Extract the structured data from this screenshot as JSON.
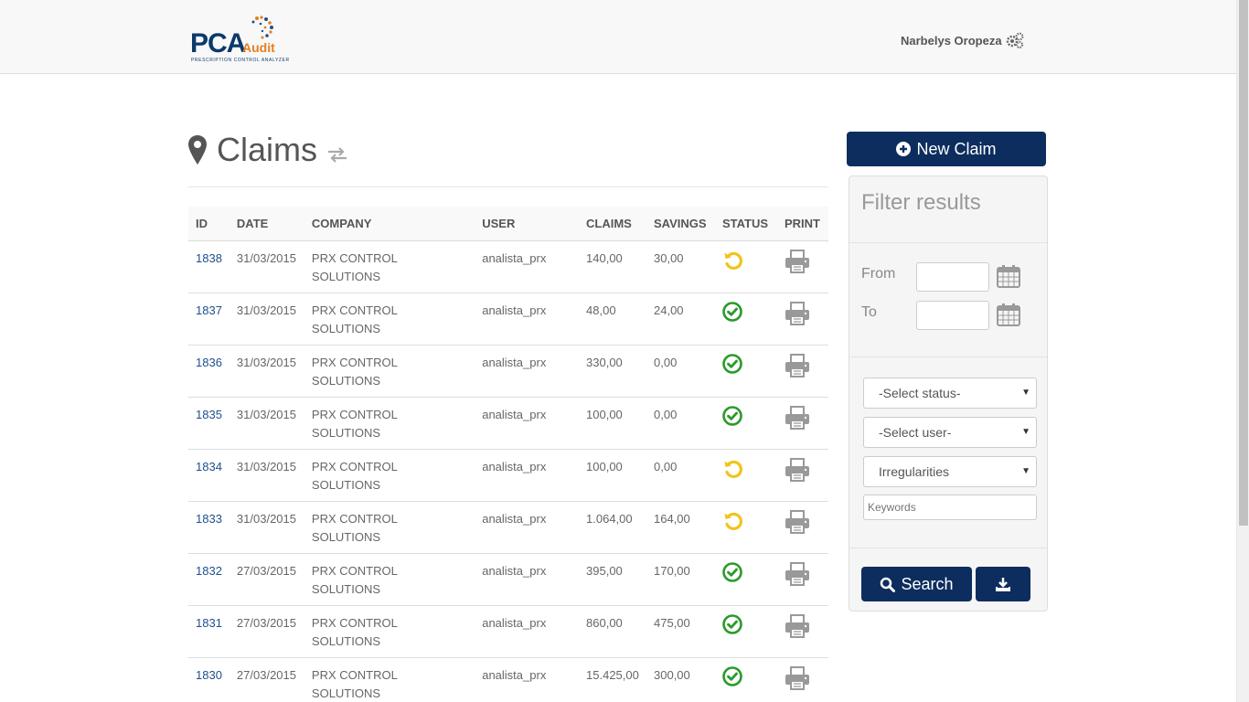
{
  "app": {
    "logo_main": "PCA",
    "logo_sub": "Audit",
    "logo_tagline": "PRESCRIPTION CONTROL ANALYZER",
    "user_name": "Narbelys Oropeza"
  },
  "page": {
    "title": "Claims"
  },
  "table": {
    "headers": {
      "id": "ID",
      "date": "DATE",
      "company": "COMPANY",
      "user": "USER",
      "claims": "CLAIMS",
      "savings": "SAVINGS",
      "status": "STATUS",
      "print": "PRINT"
    },
    "rows": [
      {
        "id": "1838",
        "date": "31/03/2015",
        "company": "PRX CONTROL SOLUTIONS",
        "user": "analista_prx",
        "claims": "140,00",
        "savings": "30,00",
        "status": "pending"
      },
      {
        "id": "1837",
        "date": "31/03/2015",
        "company": "PRX CONTROL SOLUTIONS",
        "user": "analista_prx",
        "claims": "48,00",
        "savings": "24,00",
        "status": "approved"
      },
      {
        "id": "1836",
        "date": "31/03/2015",
        "company": "PRX CONTROL SOLUTIONS",
        "user": "analista_prx",
        "claims": "330,00",
        "savings": "0,00",
        "status": "approved"
      },
      {
        "id": "1835",
        "date": "31/03/2015",
        "company": "PRX CONTROL SOLUTIONS",
        "user": "analista_prx",
        "claims": "100,00",
        "savings": "0,00",
        "status": "approved"
      },
      {
        "id": "1834",
        "date": "31/03/2015",
        "company": "PRX CONTROL SOLUTIONS",
        "user": "analista_prx",
        "claims": "100,00",
        "savings": "0,00",
        "status": "pending"
      },
      {
        "id": "1833",
        "date": "31/03/2015",
        "company": "PRX CONTROL SOLUTIONS",
        "user": "analista_prx",
        "claims": "1.064,00",
        "savings": "164,00",
        "status": "pending"
      },
      {
        "id": "1832",
        "date": "27/03/2015",
        "company": "PRX CONTROL SOLUTIONS",
        "user": "analista_prx",
        "claims": "395,00",
        "savings": "170,00",
        "status": "approved"
      },
      {
        "id": "1831",
        "date": "27/03/2015",
        "company": "PRX CONTROL SOLUTIONS",
        "user": "analista_prx",
        "claims": "860,00",
        "savings": "475,00",
        "status": "approved"
      },
      {
        "id": "1830",
        "date": "27/03/2015",
        "company": "PRX CONTROL SOLUTIONS",
        "user": "analista_prx",
        "claims": "15.425,00",
        "savings": "300,00",
        "status": "approved"
      }
    ]
  },
  "sidebar": {
    "new_claim_label": "New Claim",
    "filter_title": "Filter results",
    "from_label": "From",
    "to_label": "To",
    "from_value": "",
    "to_value": "",
    "status_select": "-Select status-",
    "user_select": "-Select user-",
    "irregularities_select": "Irregularities",
    "keywords_placeholder": "Keywords",
    "search_label": "Search"
  },
  "colors": {
    "primary": "#0d2d5e",
    "link": "#1e4f8c",
    "approved": "#2a9a2a",
    "pending": "#f0c419",
    "logo_orange": "#e67e22"
  },
  "icons": {
    "title": "map-marker-icon",
    "toggle": "exchange-icon",
    "user": "gears-icon",
    "status_approved": "check-circle-icon",
    "status_pending": "undo-icon",
    "print": "print-icon",
    "calendar": "calendar-icon",
    "new": "plus-circle-icon",
    "search": "search-icon",
    "download": "download-icon"
  }
}
